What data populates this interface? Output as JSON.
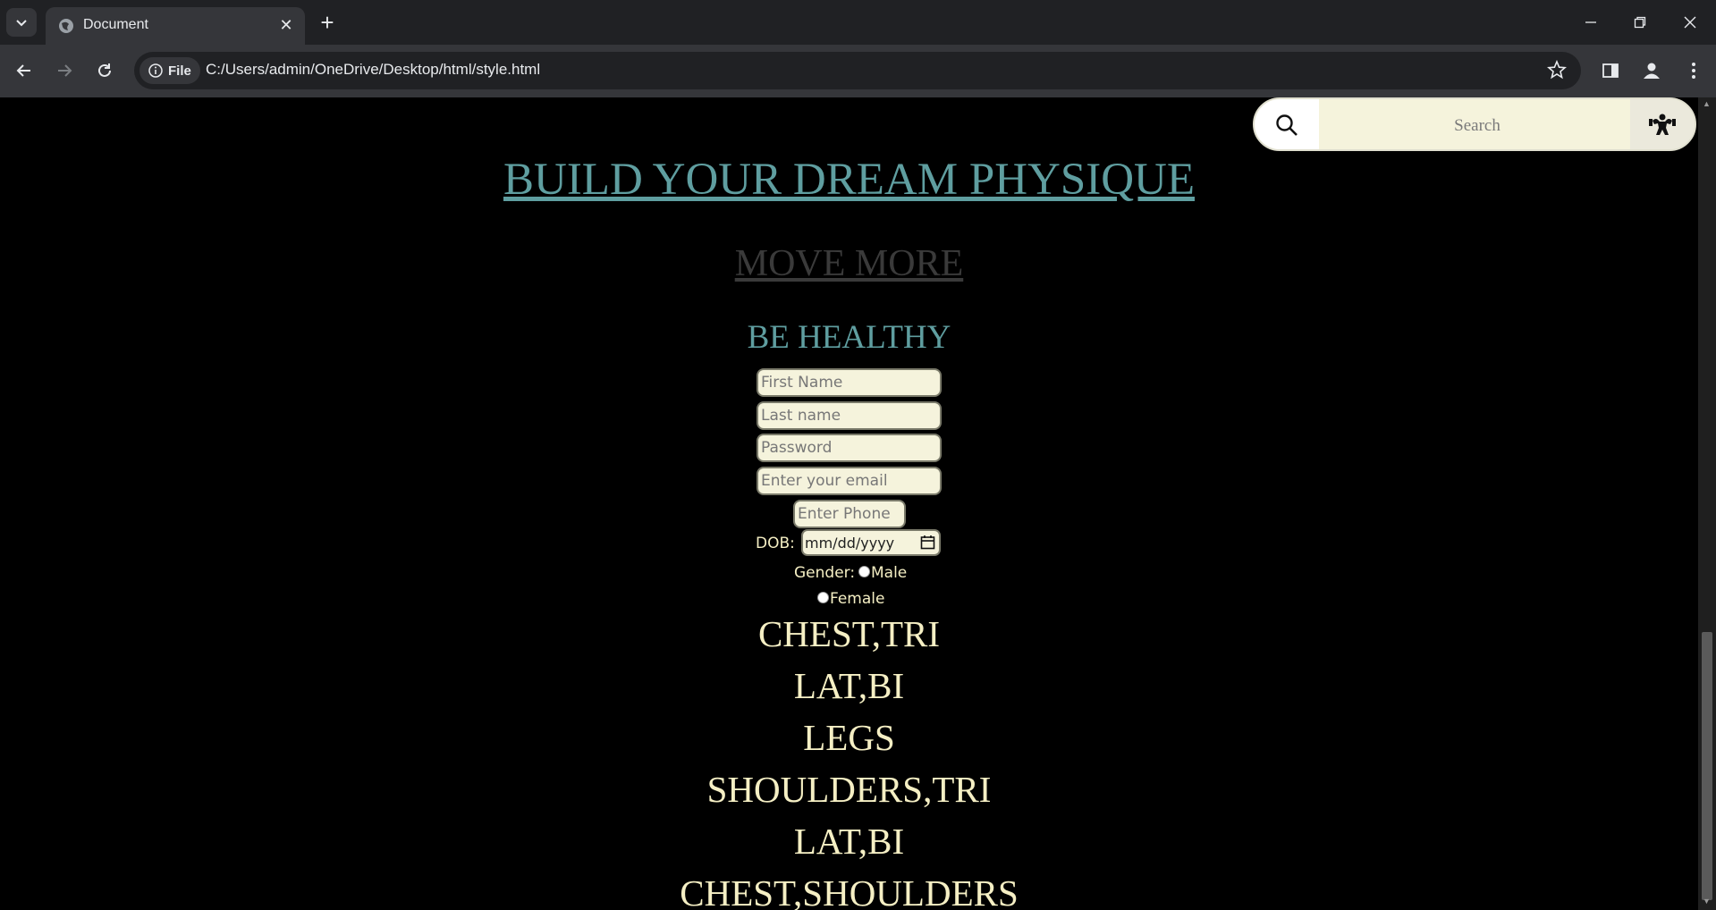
{
  "browser": {
    "tab_title": "Document",
    "url_chip": "File",
    "url": "C:/Users/admin/OneDrive/Desktop/html/style.html"
  },
  "page": {
    "search_placeholder": "Search",
    "heading": "BUILD YOUR DREAM PHYSIQUE",
    "subheading": "MOVE MORE",
    "tagline": "BE HEALTHY",
    "form": {
      "first_name_placeholder": "First Name",
      "last_name_placeholder": "Last name",
      "password_placeholder": "Password",
      "email_placeholder": "Enter your email",
      "phone_placeholder": "Enter Phone",
      "dob_label": "DOB:",
      "dob_value": "mm/dd/yyyy",
      "gender_label": "Gender:",
      "male_label": "Male",
      "female_label": "Female"
    },
    "workouts": [
      "CHEST,TRI",
      "LAT,BI",
      "LEGS",
      "SHOULDERS,TRI",
      "LAT,BI",
      "CHEST,SHOULDERS"
    ]
  },
  "colors": {
    "heading": "#5f9ea0",
    "subheading": "#3a3a3a",
    "text": "#f5efc4",
    "field_bg": "#f5f3dc",
    "page_bg": "#000000"
  }
}
